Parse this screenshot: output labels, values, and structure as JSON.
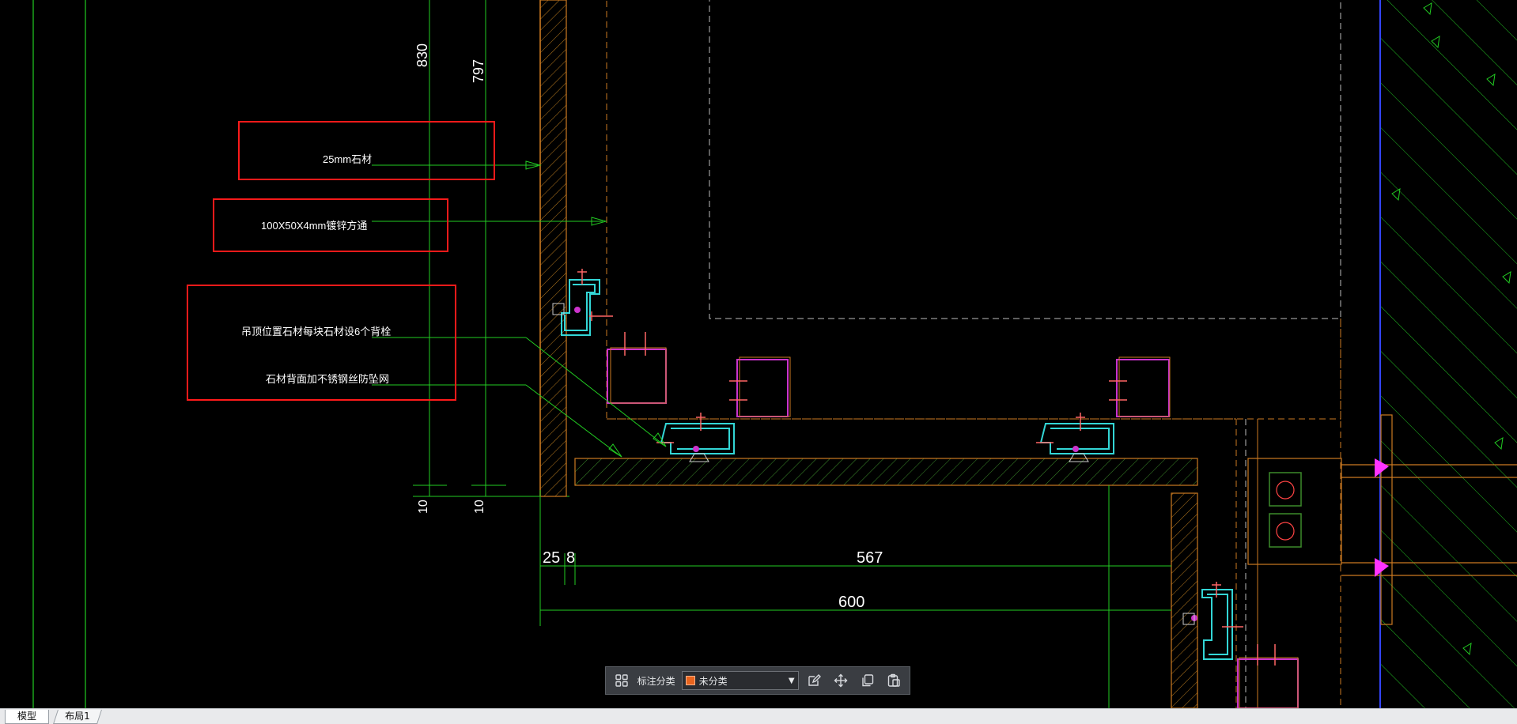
{
  "drawing": {
    "dimensions": {
      "d830": "830",
      "d797": "797",
      "d10a": "10",
      "d10b": "10",
      "d25": "25",
      "d8": "8",
      "d567": "567",
      "d600": "600"
    },
    "annotations": [
      {
        "text": "25mm石材"
      },
      {
        "text": "100X50X4mm镀锌方通"
      },
      {
        "text": "吊顶位置石材每块石材设6个背栓"
      },
      {
        "text": "石材背面加不锈钢丝防坠网"
      }
    ],
    "colors": {
      "background": "#000000",
      "dim_green": "#22cc22",
      "outline_orange": "#cc7a22",
      "bracket_cyan": "#33d6d6",
      "tube_magenta": "#cc33cc",
      "annot_red": "#ff1a1a"
    }
  },
  "toolbar": {
    "layers_icon": "grid-icon",
    "category_label": "标注分类",
    "category_value": "未分类",
    "category_color": "#e8641e",
    "edit_icon": "edit-icon",
    "move_icon": "move-icon",
    "copy_icon": "copy-icon",
    "paste_icon": "paste-icon"
  },
  "tabs": [
    {
      "label": "模型",
      "active": true
    },
    {
      "label": "布局1",
      "active": false
    }
  ]
}
